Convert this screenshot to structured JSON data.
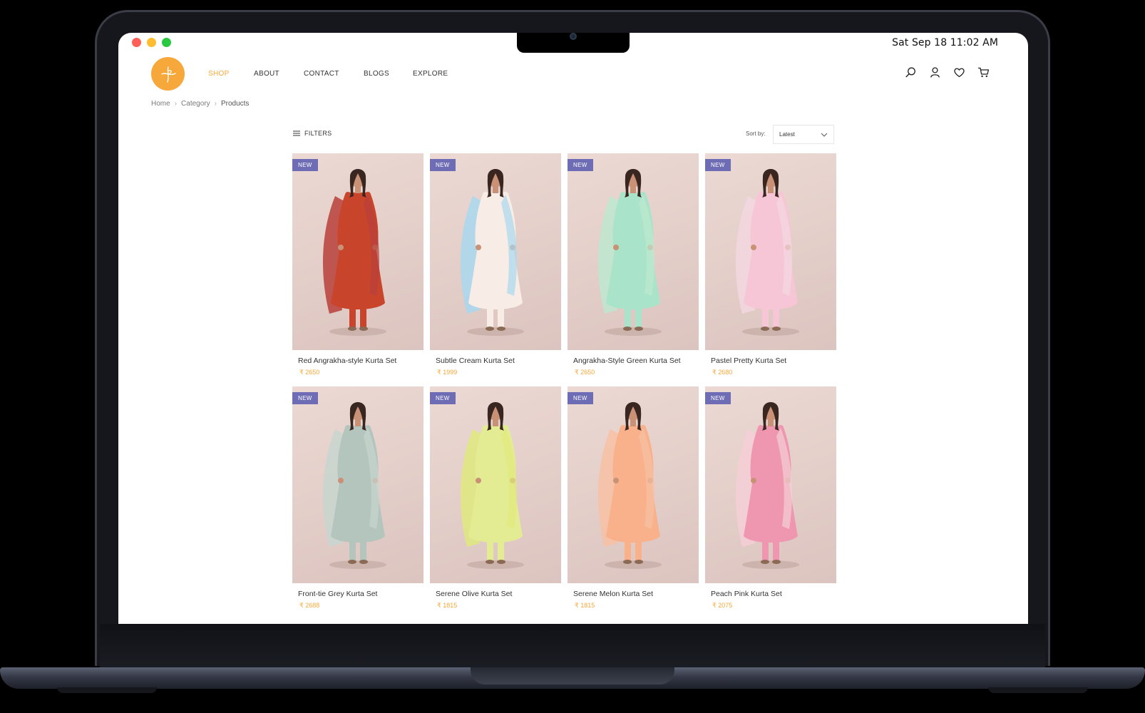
{
  "clock": "Sat Sep 18  11:02 AM",
  "nav": {
    "items": [
      {
        "label": "SHOP",
        "active": true
      },
      {
        "label": "ABOUT"
      },
      {
        "label": "CONTACT"
      },
      {
        "label": "BLOGS"
      },
      {
        "label": "EXPLORE"
      }
    ]
  },
  "header_icons": [
    "search-icon",
    "user-icon",
    "heart-icon",
    "cart-icon"
  ],
  "breadcrumb": [
    "Home",
    "Category",
    "Products"
  ],
  "toolbar": {
    "filters_label": "FILTERS",
    "sort_label": "Sort by:",
    "sort_value": "Latest"
  },
  "colors": {
    "accent": "#f6a83a",
    "badge": "#6f6cb6"
  },
  "products": [
    {
      "badge": "NEW",
      "name": "Red Angrakha-style Kurta Set",
      "price": "₹ 2650",
      "dress_color": "#c8452c",
      "scarf_color": "#b8403a"
    },
    {
      "badge": "NEW",
      "name": "Subtle Cream Kurta Set",
      "price": "₹ 1999",
      "dress_color": "#f7ece6",
      "scarf_color": "#a9d8ee"
    },
    {
      "badge": "NEW",
      "name": "Angrakha-Style Green Kurta Set",
      "price": "₹ 2650",
      "dress_color": "#a9e3c9",
      "scarf_color": "#bde8cf"
    },
    {
      "badge": "NEW",
      "name": "Pastel Pretty Kurta Set",
      "price": "₹ 2680",
      "dress_color": "#f6c6d6",
      "scarf_color": "#f3d7e1"
    },
    {
      "badge": "NEW",
      "name": "Front-tie Grey Kurta Set",
      "price": "₹ 2688",
      "dress_color": "#b3c5bd",
      "scarf_color": "#c7d6cf"
    },
    {
      "badge": "NEW",
      "name": "Serene Olive Kurta Set",
      "price": "₹ 1815",
      "dress_color": "#e3ec92",
      "scarf_color": "#dfe97e"
    },
    {
      "badge": "NEW",
      "name": "Serene Melon Kurta Set",
      "price": "₹ 1815",
      "dress_color": "#f8b18a",
      "scarf_color": "#f7c1a3"
    },
    {
      "badge": "NEW",
      "name": "Peach Pink Kurta Set",
      "price": "₹ 2075",
      "dress_color": "#ef97b0",
      "scarf_color": "#f4cfd6"
    }
  ]
}
